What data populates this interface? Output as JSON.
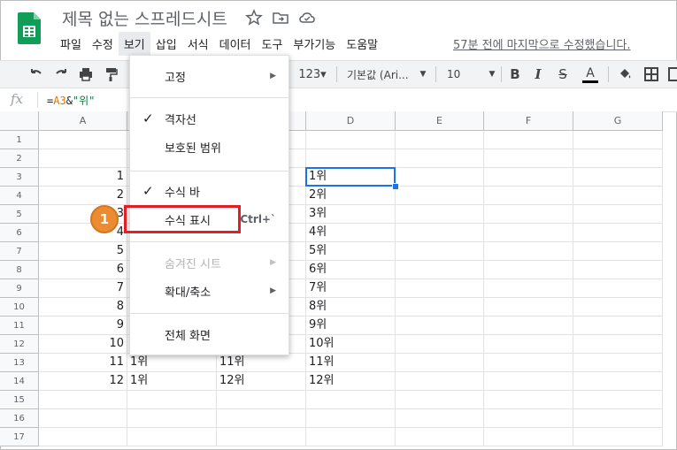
{
  "app": {
    "doc_title": "제목 없는 스프레드시트",
    "last_edit": "57분 전에 마지막으로 수정했습니다."
  },
  "menu": [
    "파일",
    "수정",
    "보기",
    "삽입",
    "서식",
    "데이터",
    "도구",
    "부가기능",
    "도움말"
  ],
  "active_menu": "보기",
  "toolbar": {
    "number_format": "123▾",
    "font": "기본값 (Ari...",
    "font_size": "10",
    "bold": "B",
    "italic": "I",
    "strike": "S",
    "text_color": "A"
  },
  "formula_bar": {
    "fx": "fx",
    "eq": "=",
    "ref": "A3",
    "amp": "&",
    "str": "\"위\""
  },
  "columns": [
    "A",
    "B",
    "C",
    "D",
    "E",
    "F",
    "G"
  ],
  "rows": [
    "1",
    "2",
    "3",
    "4",
    "5",
    "6",
    "7",
    "8",
    "9",
    "10",
    "11",
    "12",
    "13",
    "14",
    "15",
    "16",
    "17"
  ],
  "cells": {
    "A": [
      "",
      "",
      "1",
      "2",
      "3",
      "4",
      "5",
      "6",
      "7",
      "8",
      "9",
      "10",
      "11",
      "12",
      "",
      "",
      ""
    ],
    "B": [
      "",
      "",
      "",
      "",
      "",
      "",
      "",
      "",
      "",
      "",
      "",
      "",
      "1위",
      "1위",
      "",
      "",
      ""
    ],
    "C": [
      "",
      "",
      "",
      "",
      "",
      "",
      "",
      "",
      "",
      "",
      "",
      "",
      "11위",
      "12위",
      "",
      "",
      ""
    ],
    "D": [
      "",
      "",
      "1위",
      "2위",
      "3위",
      "4위",
      "5위",
      "6위",
      "7위",
      "8위",
      "9위",
      "10위",
      "11위",
      "12위",
      "",
      "",
      ""
    ]
  },
  "view_menu": {
    "freeze": "고정",
    "gridlines": "격자선",
    "protected_ranges": "보호된 범위",
    "formula_bar": "수식 바",
    "show_formulas": "수식 표시",
    "show_formulas_shortcut": "Ctrl+`",
    "hidden_sheets": "숨겨진 시트",
    "zoom": "확대/축소",
    "full_screen": "전체 화면",
    "check": "✓",
    "arrow": "▶"
  },
  "annotation": {
    "step": "1"
  },
  "colors": {
    "accent": "#1a73e8",
    "highlight": "#e31e24",
    "badge": "#ec8c32"
  }
}
